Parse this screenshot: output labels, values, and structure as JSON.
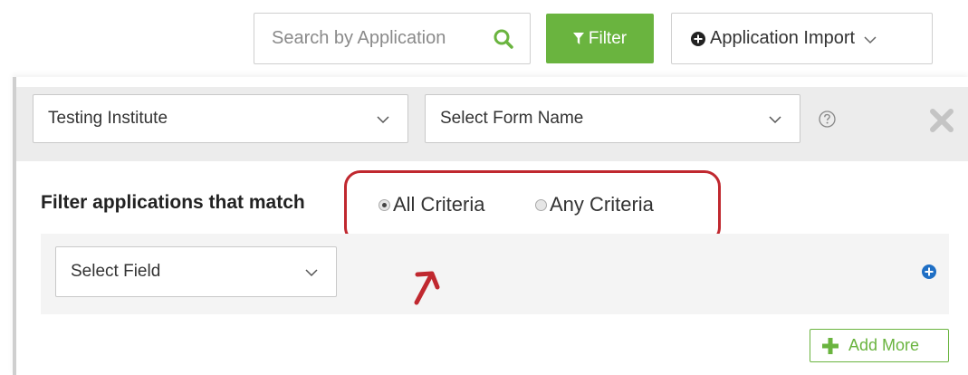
{
  "toolbar": {
    "search_placeholder": "Search by Application",
    "filter_label": "Filter",
    "import_label": "Application Import"
  },
  "filter_panel": {
    "institute_value": "Testing Institute",
    "form_placeholder": "Select Form Name",
    "match_label": "Filter applications that match",
    "match_options": [
      {
        "label": "All Criteria",
        "checked": true
      },
      {
        "label": "Any Criteria",
        "checked": false
      }
    ],
    "field_placeholder": "Select Field",
    "add_more_label": "Add More"
  },
  "icons": {
    "search": "search-icon",
    "filter": "funnel-icon",
    "import": "plus-circle-icon",
    "chevron": "chevron-down-icon",
    "help": "question-circle-icon",
    "close": "close-icon",
    "add_row": "plus-circle-icon",
    "add_more": "plus-icon"
  },
  "colors": {
    "accent_green": "#6ab43f",
    "highlight_red": "#c0282f",
    "add_blue": "#1f6fc5"
  }
}
